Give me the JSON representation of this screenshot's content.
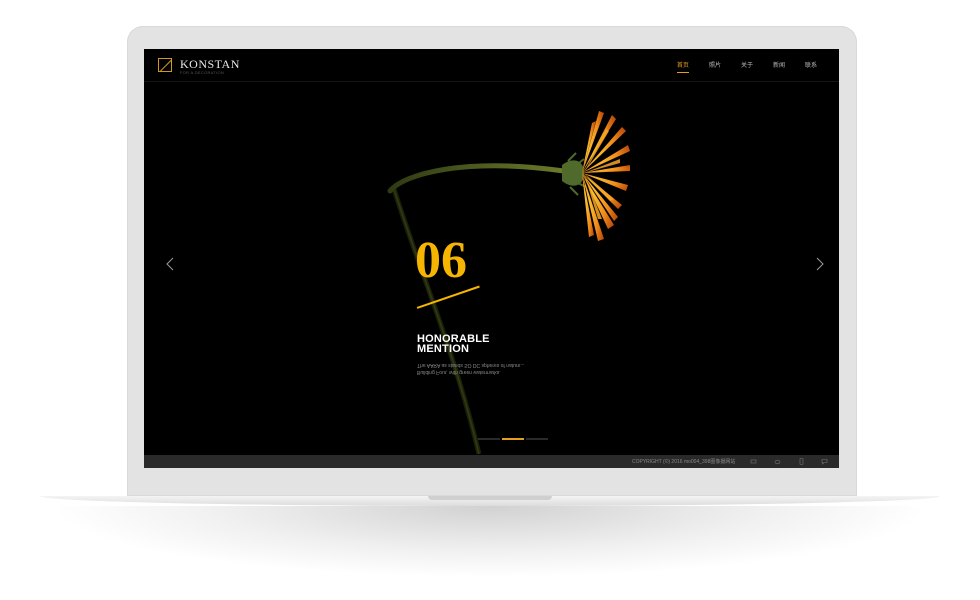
{
  "site": {
    "logo_text": "KONSTAN",
    "logo_sub": "FOR A DECORATION",
    "logo_icon": "slash-square-icon"
  },
  "nav": {
    "items": [
      {
        "label": "首页",
        "active": true
      },
      {
        "label": "照片",
        "active": false
      },
      {
        "label": "关于",
        "active": false
      },
      {
        "label": "新闻",
        "active": false
      },
      {
        "label": "联系",
        "active": false
      }
    ]
  },
  "slide": {
    "number": "06",
    "title_line1": "HONORABLE",
    "title_line2": "MENTION",
    "desc_line1": "Building Four, with green watermarks.",
    "desc_line2": "The AARA as stands SO DC spheres of nature..."
  },
  "carousel": {
    "prev_icon": "chevron-left-icon",
    "next_icon": "chevron-right-icon",
    "slides_total": 3,
    "active_index": 1
  },
  "footer": {
    "copyright": "COPYRIGHT (©) 2016 mo004_398图像摄网站",
    "icons": [
      "share-icon",
      "weibo-icon",
      "mobile-icon",
      "chat-icon"
    ]
  },
  "colors": {
    "accent": "#f5b500",
    "nav_active": "#e3a01c",
    "background": "#000000",
    "footer_bg": "#2a2a2a"
  }
}
